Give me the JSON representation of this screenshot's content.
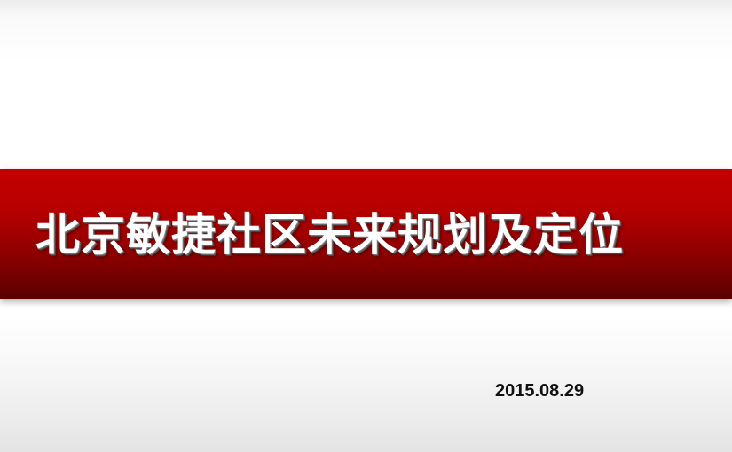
{
  "slide": {
    "title": "北京敏捷社区未来规划及定位",
    "date": "2015.08.29",
    "colors": {
      "band_top": "#c40000",
      "band_bottom": "#5a0000",
      "title_text": "#ffffff",
      "date_text": "#111111"
    }
  }
}
